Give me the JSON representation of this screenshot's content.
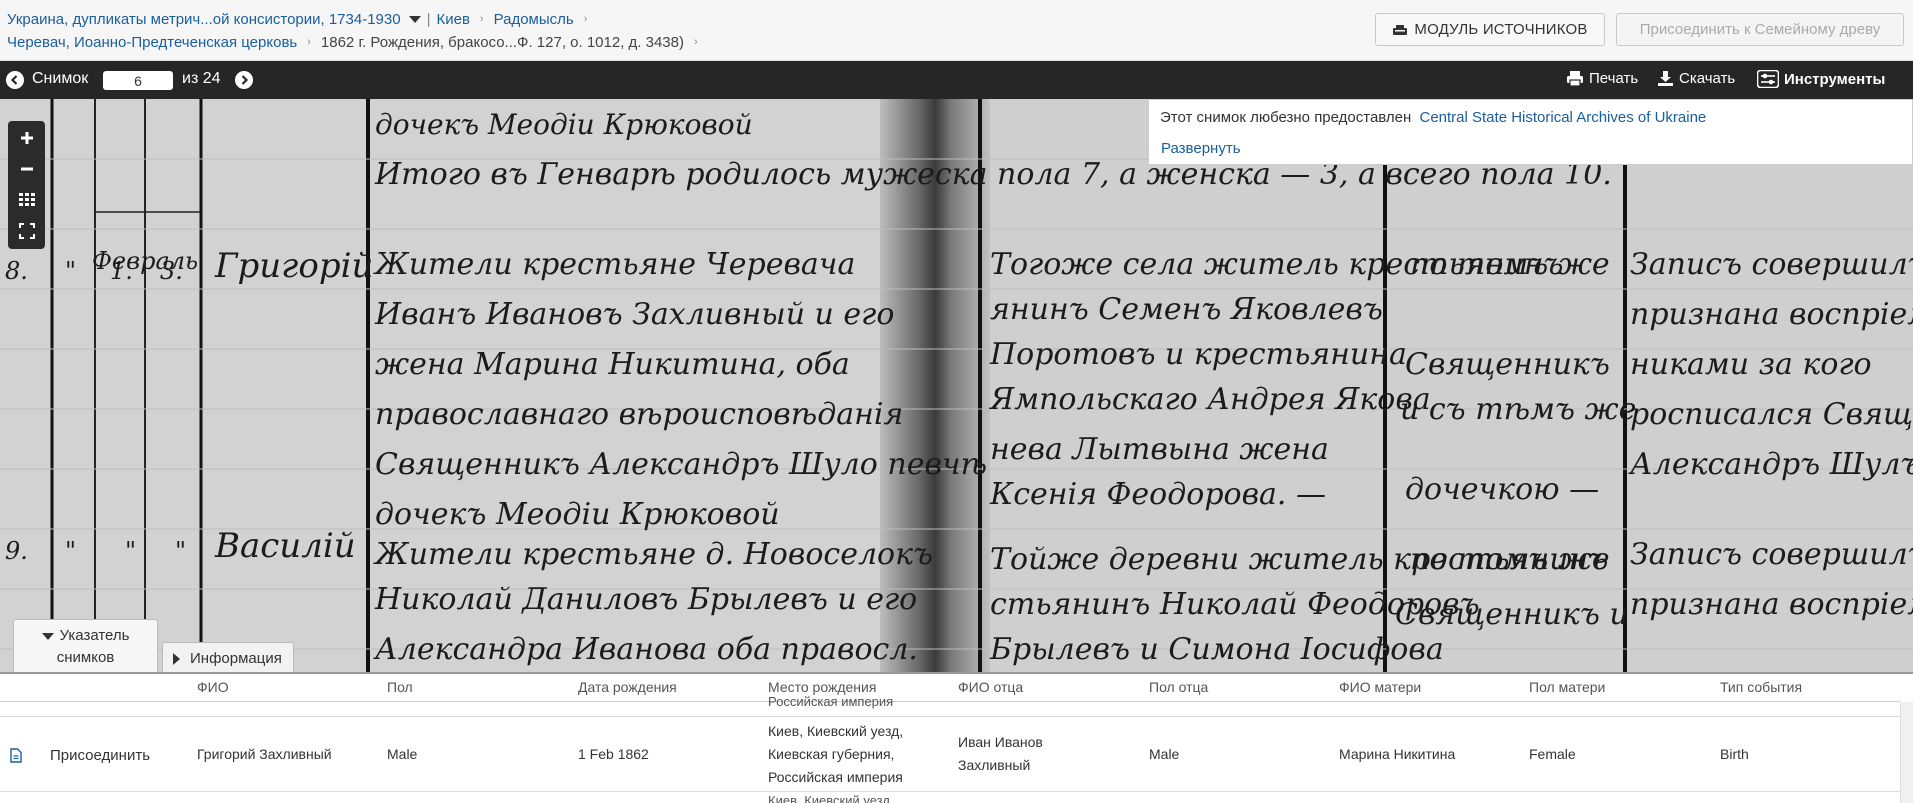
{
  "header": {
    "collection_title": "Украина, дупликаты метрич...ой консистории, 1734-1930",
    "breadcrumb": [
      "Киев",
      "Радомысль"
    ],
    "second_row": [
      "Черевач, Иоанно-Предтеченская церковь",
      "1862 г. Рождения, бракосо...Ф. 127, о. 1012, д. 3438)"
    ],
    "sources_button": "МОДУЛЬ ИСТОЧНИКОВ",
    "join_tree_button": "Присоединить к Семейному древу"
  },
  "toolbar": {
    "image_label": "Снимок",
    "image_number": "6",
    "of_total": "из 24",
    "print": "Печать",
    "download": "Скачать",
    "tools": "Инструменты"
  },
  "credit": {
    "text": "Этот снимок любезно предоставлен",
    "source_link": "Central State Historical Archives of Ukraine",
    "expand": "Развернуть"
  },
  "tabs": {
    "index_line1": "Указатель",
    "index_line2": "снимков",
    "info": "Информация"
  },
  "table": {
    "headers": [
      "ФИО",
      "Пол",
      "Дата рождения",
      "Место рождения",
      "ФИО отца",
      "Пол отца",
      "ФИО матери",
      "Пол матери",
      "Тип события"
    ],
    "prev_row_place_tail": "Российская империя",
    "row": {
      "action": "Присоединить",
      "name": "Григорий Захливный",
      "sex": "Male",
      "birth_date": "1 Feb 1862",
      "birth_place": [
        "Киев, Киевский уезд,",
        "Киевская губерния,",
        "Российская империя"
      ],
      "father_name": [
        "Иван Иванов",
        "Захливный"
      ],
      "father_sex": "Male",
      "mother_name": "Марина Никитина",
      "mother_sex": "Female",
      "event_type": "Birth"
    },
    "next_row_place_head": "Киев, Киевский уезд"
  },
  "colors": {
    "link": "#1a5e9f",
    "toolbar_bg": "#262626",
    "paper": "#cfcfcf"
  },
  "icons": [
    "chevron-left-icon",
    "chevron-right-icon",
    "printer-icon",
    "download-icon",
    "sliders-icon",
    "zoom-in-icon",
    "zoom-out-icon",
    "grid-icon",
    "fullscreen-icon",
    "document-icon",
    "cash-register-icon"
  ]
}
